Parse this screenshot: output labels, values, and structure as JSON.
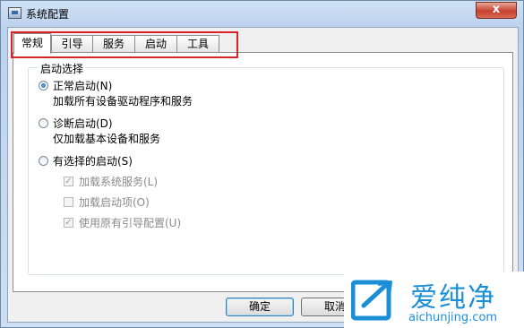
{
  "window": {
    "title": "系统配置",
    "close_label": "x"
  },
  "tabs": [
    {
      "label": "常规",
      "active": true
    },
    {
      "label": "引导",
      "active": false
    },
    {
      "label": "服务",
      "active": false
    },
    {
      "label": "启动",
      "active": false
    },
    {
      "label": "工具",
      "active": false
    }
  ],
  "startup": {
    "group_label": "启动选择",
    "normal": {
      "label": "正常启动(N)",
      "desc": "加载所有设备驱动程序和服务",
      "selected": true
    },
    "diagnostic": {
      "label": "诊断启动(D)",
      "desc": "仅加载基本设备和服务",
      "selected": false
    },
    "selective": {
      "label": "有选择的启动(S)",
      "selected": false,
      "options": [
        {
          "label": "加载系统服务(L)",
          "checked": true,
          "enabled": false
        },
        {
          "label": "加载启动项(O)",
          "checked": false,
          "enabled": false
        },
        {
          "label": "使用原有引导配置(U)",
          "checked": true,
          "enabled": false
        }
      ]
    }
  },
  "buttons": {
    "ok": "确定",
    "cancel": "取消"
  },
  "watermark": {
    "brand": "爱纯净",
    "url": "aichunjing.com"
  },
  "colors": {
    "highlight": "#d9232a",
    "brand": "#1a8fd8"
  }
}
